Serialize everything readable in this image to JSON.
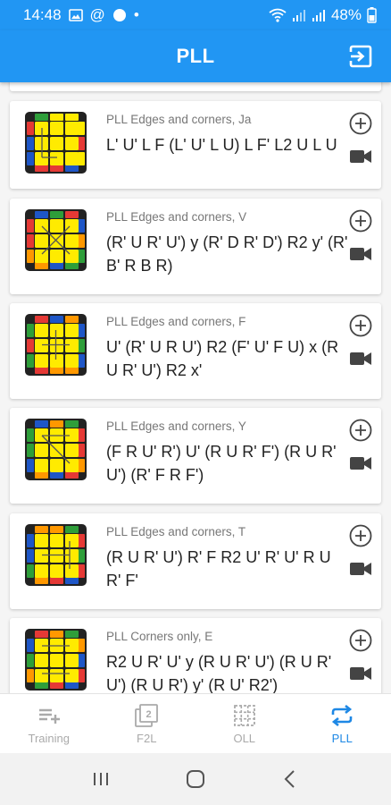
{
  "status_bar": {
    "time": "14:48",
    "at_symbol": "@",
    "dot": "•",
    "battery": "48%"
  },
  "app_bar": {
    "title": "PLL"
  },
  "colors": {
    "primary": "#2196f3",
    "accent_active": "#1e88e5",
    "cube_yellow": "#ffeb00",
    "cube_red": "#e53935",
    "cube_green": "#2e9e3a",
    "cube_blue": "#1e56c7",
    "cube_orange": "#ff9800"
  },
  "algorithms": [
    {
      "name": "PLL Edges and corners, Ja",
      "alg": "L' U' L F (L' U' L U) L F' L2 U L U",
      "side": {
        "top": [
          "green",
          "yellow",
          "yellow"
        ],
        "right": [
          "yellow",
          "red",
          "yellow"
        ],
        "bottom": [
          "red",
          "red",
          "blue"
        ],
        "left": [
          "red",
          "blue",
          "blue"
        ]
      }
    },
    {
      "name": "PLL Edges and corners, V",
      "alg": "(R' U R' U') y (R' D R' D') R2 y' (R' B' R B R)",
      "side": {
        "top": [
          "blue",
          "green",
          "red"
        ],
        "right": [
          "blue",
          "orange",
          "green"
        ],
        "bottom": [
          "orange",
          "blue",
          "green"
        ],
        "left": [
          "red",
          "red",
          "orange"
        ]
      }
    },
    {
      "name": "PLL Edges and corners, F",
      "alg": "U' (R' U R U') R2 (F' U' F U) x (R U R' U') R2 x'",
      "side": {
        "top": [
          "red",
          "blue",
          "orange"
        ],
        "right": [
          "blue",
          "green",
          "blue"
        ],
        "bottom": [
          "red",
          "orange",
          "orange"
        ],
        "left": [
          "green",
          "red",
          "green"
        ]
      }
    },
    {
      "name": "PLL Edges and corners, Y",
      "alg": "(F R U' R') U' (R U R' F') (R U R' U') (R' F R F')",
      "side": {
        "top": [
          "blue",
          "orange",
          "green"
        ],
        "right": [
          "red",
          "red",
          "orange"
        ],
        "bottom": [
          "orange",
          "blue",
          "red"
        ],
        "left": [
          "green",
          "green",
          "blue"
        ]
      }
    },
    {
      "name": "PLL Edges and corners, T",
      "alg": "(R U R' U') R' F R2 U' R' U' R U R' F'",
      "side": {
        "top": [
          "orange",
          "orange",
          "green"
        ],
        "right": [
          "red",
          "green",
          "red"
        ],
        "bottom": [
          "orange",
          "red",
          "blue"
        ],
        "left": [
          "blue",
          "blue",
          "green"
        ]
      }
    },
    {
      "name": "PLL Corners only, E",
      "alg": "R2 U R' U' y (R U R' U') (R U R' U') (R U R') y' (R U' R2')",
      "side": {
        "top": [
          "red",
          "orange",
          "green"
        ],
        "right": [
          "orange",
          "blue",
          "red"
        ],
        "bottom": [
          "green",
          "red",
          "blue"
        ],
        "left": [
          "blue",
          "green",
          "orange"
        ]
      }
    }
  ],
  "bottom_nav": [
    {
      "label": "Training",
      "icon": "training-list-add-icon",
      "active": false
    },
    {
      "label": "F2L",
      "icon": "f2l-icon",
      "active": false
    },
    {
      "label": "OLL",
      "icon": "oll-grid-icon",
      "active": false
    },
    {
      "label": "PLL",
      "icon": "pll-swap-icon",
      "active": true
    }
  ]
}
